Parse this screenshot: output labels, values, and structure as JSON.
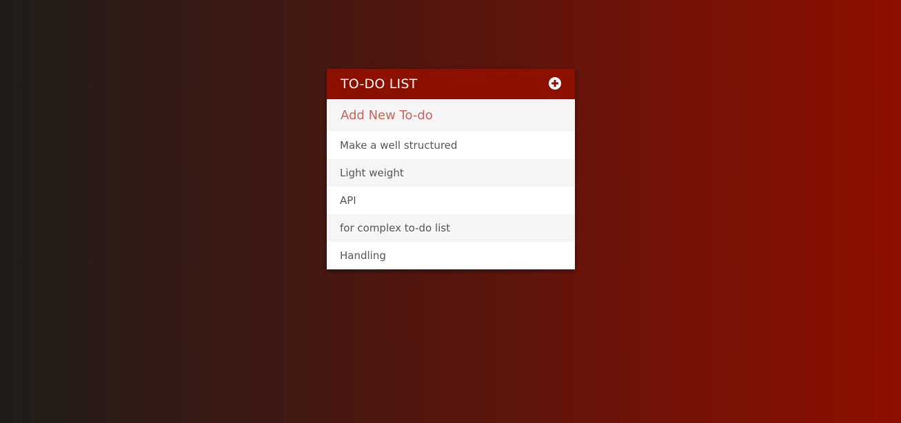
{
  "header": {
    "title": "TO-DO LIST",
    "add_icon": "plus-circle-icon"
  },
  "input": {
    "placeholder": "Add New To-do",
    "value": ""
  },
  "items": [
    {
      "label": "Make a well structured"
    },
    {
      "label": "Light weight"
    },
    {
      "label": "API"
    },
    {
      "label": "for complex to-do list"
    },
    {
      "label": "Handling"
    }
  ],
  "colors": {
    "accent": "#8c1000",
    "placeholder": "#c0665a",
    "item_text": "#555555"
  }
}
